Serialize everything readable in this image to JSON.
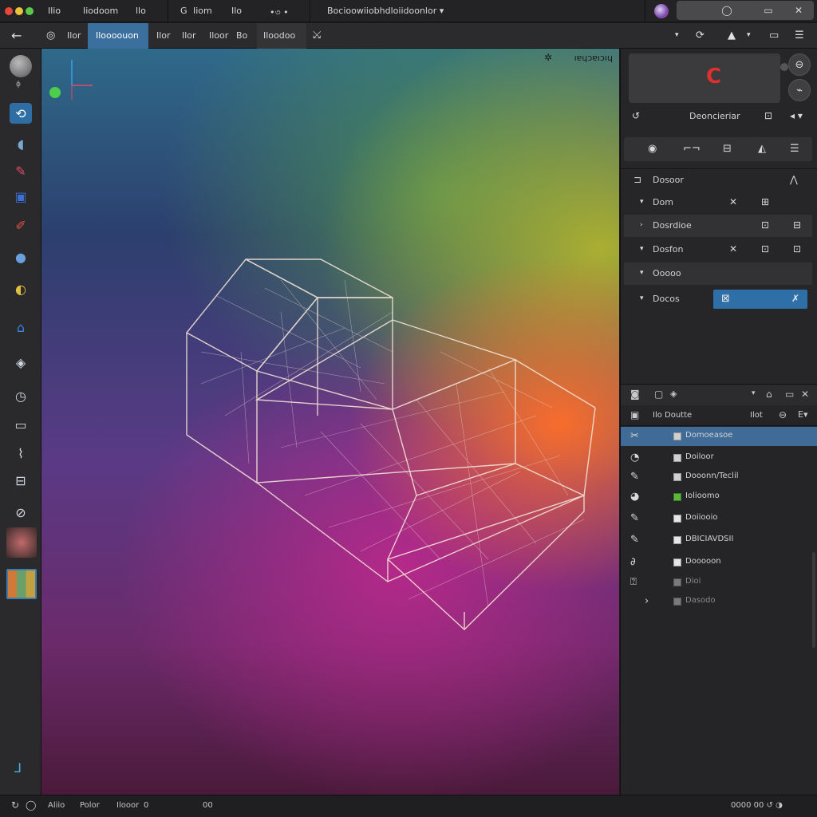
{
  "titlebar": {
    "menu": [
      "Ilio",
      "Iiodoom",
      "llo"
    ],
    "tool_a": "G",
    "tool_b": "Iiom",
    "tool_c": "Ilo",
    "tool_d": "•৩ •",
    "document_title": "Bocioowiiobhdloiidoonlor ▾",
    "win_buttons": [
      "◯",
      "▭",
      "✕"
    ]
  },
  "toolbar": {
    "back_icon": "←",
    "items": [
      "Ilor",
      "Iloooouon",
      "Ilor",
      "Ilor",
      "Iloor",
      "Bo",
      "Iloodoo"
    ],
    "extra_icon": "⤩",
    "right_icons": [
      "▾",
      "⟳",
      "▲",
      "▾",
      "▭",
      "☰"
    ]
  },
  "toolbox": {
    "top_hint": "ɸ",
    "tools": [
      "sphere-tool",
      "rotate-tool",
      "fish-tool",
      "paint-tool",
      "canvas-tool",
      "brush-tool",
      "globe-tool",
      "balloon-tool",
      "house-tool",
      "lasso-tool",
      "clock-tool",
      "monitor-tool",
      "bird-tool",
      "slider-tool",
      "circle-tool"
    ],
    "axis_glyph": "⅃"
  },
  "viewport": {
    "label": "ıɐɥɔɐıɔıɥ"
  },
  "rightpanel": {
    "header_row": {
      "label": "Deoncieriar",
      "icon_left": "↺",
      "icon_mid": "⊡",
      "icon_right": "◂ ▾"
    },
    "seg_icons": [
      "◉",
      "⌐¬",
      "⊟",
      "◭",
      "☰"
    ],
    "section_title": "Dosoor",
    "rows": [
      {
        "label": "Dom",
        "mid": "✕",
        "right": "⊞"
      },
      {
        "label": "Dosrdioe",
        "mid": "",
        "right": "⊡"
      },
      {
        "label": "Dosfon",
        "mid": "✕",
        "right": "⊡"
      },
      {
        "label": "Ooooo",
        "mid": "",
        "right": ""
      },
      {
        "label": "Docos",
        "mid": "",
        "right": ""
      }
    ]
  },
  "layers": {
    "header_label": "Ilo Doutte",
    "header_right": "Ilot",
    "items": [
      {
        "icon": "✂",
        "name": "Domoeasoe",
        "swatch": "#d6d6d6"
      },
      {
        "icon": "◔",
        "name": "Doiloor",
        "swatch": "#cfcfcf"
      },
      {
        "icon": "✎",
        "name": "Dooonn/Teclil",
        "swatch": "#cfcfcf"
      },
      {
        "icon": "◕",
        "name": "Iolioomo",
        "swatch": "#5bb83a"
      },
      {
        "icon": "✎",
        "name": "Doiiooio",
        "swatch": "#e6e6e6"
      },
      {
        "icon": "✎",
        "name": "DBICIAVDSII",
        "swatch": "#e6e6e6"
      },
      {
        "icon": "∂",
        "name": "Dooooon",
        "swatch": "#e6e6e6"
      },
      {
        "icon": "⍰",
        "name": "Dioi",
        "swatch": "#7a7a7a"
      },
      {
        "icon": "›",
        "name": "Dasodo",
        "swatch": "#7a7a7a"
      }
    ]
  },
  "statusbar": {
    "left_icons": [
      "↻",
      "◯"
    ],
    "items": [
      "Aliio",
      "Polor",
      "Ilooor",
      "0",
      "00"
    ],
    "right": "0000 00 ↺ ◑"
  }
}
